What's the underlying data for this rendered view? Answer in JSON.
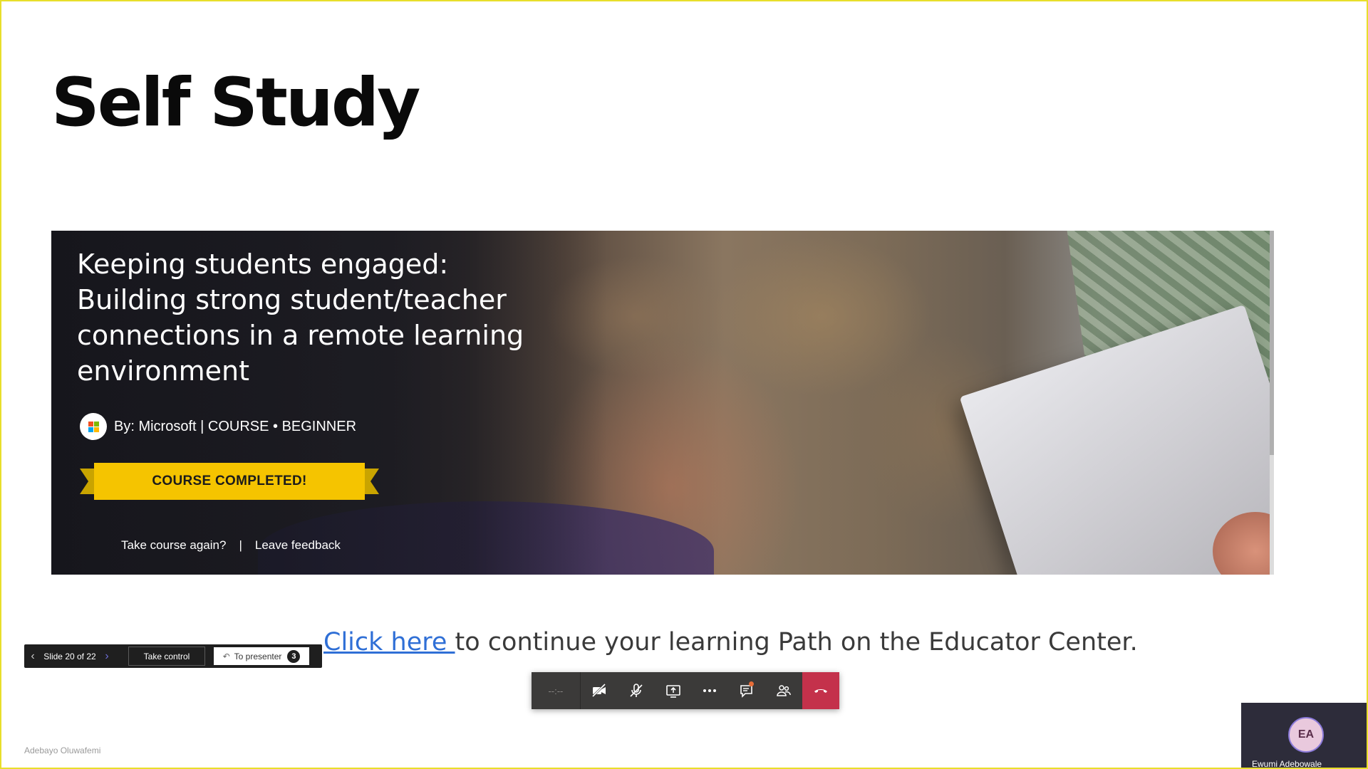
{
  "slide": {
    "title": "Self Study"
  },
  "course_banner": {
    "title": "Keeping students engaged: Building strong student/teacher connections in a remote learning environment",
    "byline": "By: Microsoft | COURSE • BEGINNER",
    "status": "COURSE COMPLETED!",
    "take_again": "Take course again?",
    "separator": "|",
    "feedback": "Leave feedback",
    "ms_logo_colors": [
      "#f25022",
      "#7fba00",
      "#00a4ef",
      "#ffb900"
    ]
  },
  "continue_line": {
    "link_text": "Click here ",
    "rest_text": "to continue your learning Path on the Educator Center."
  },
  "presenter_bar": {
    "prev_icon": "chevron-left-icon",
    "slide_counter": "Slide 20 of 22",
    "next_icon": "chevron-right-icon",
    "take_control": "Take control",
    "to_presenter": "To presenter",
    "to_presenter_badge": "3"
  },
  "meeting_toolbar": {
    "timer": "--:--",
    "buttons": [
      {
        "name": "camera-off-icon"
      },
      {
        "name": "mic-off-icon"
      },
      {
        "name": "share-icon"
      },
      {
        "name": "more-icon"
      },
      {
        "name": "chat-icon"
      },
      {
        "name": "participants-icon"
      },
      {
        "name": "hang-up-icon"
      }
    ],
    "hangup_color": "#c4314b"
  },
  "participant": {
    "initials": "EA",
    "name": "Ewumi Adebowale"
  },
  "presenter_name": "Adebayo Oluwafemi",
  "colors": {
    "frame_border": "#e8df2a",
    "link": "#2f6fd6",
    "ribbon": "#f5c400"
  }
}
